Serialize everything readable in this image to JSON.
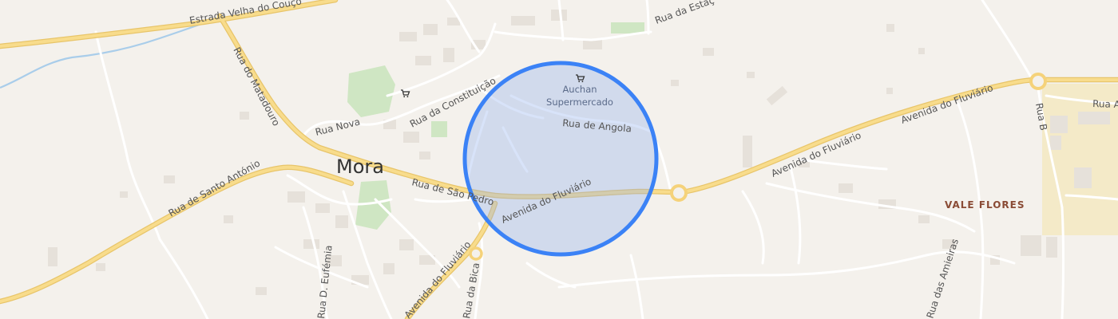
{
  "map": {
    "colors": {
      "background": "#f4f1ec",
      "major_road": "#f5d27a",
      "minor_road": "#ffffff",
      "park": "#cfe6c3",
      "water": "#a9cdea",
      "building": "#e6e1da",
      "industrial": "#f4eac8",
      "radius_fill": "#8fb0ef",
      "radius_stroke": "#3b82f6"
    },
    "labels": {
      "town": "Mora",
      "district": "VALE FLORES",
      "poi_name_line1": "Auchan",
      "poi_name_line2": "Supermercado",
      "road_estrada_velha": "Estrada Velha do Couço",
      "road_matadouro": "Rua do Matadouro",
      "road_nova": "Rua Nova",
      "road_constituicao": "Rua da Constituição",
      "road_angola": "Rua de Angola",
      "road_sao_pedro": "Rua de São Pedro",
      "road_santo_antonio": "Rua de Santo António",
      "road_fluviario_center": "Avenida do Fluviário",
      "road_fluviario_east1": "Avenida do Fluviário",
      "road_fluviario_east2": "Avenida do Fluviário",
      "road_fluviario_south": "Avenida do Fluviário",
      "road_estacao": "Rua da Estaç",
      "road_b": "Rua B",
      "road_a": "Rua A",
      "road_bica": "Rua da Bica",
      "road_amieiras": "Rua das Amieiras",
      "road_eufemia": "Rua D. Eufémia"
    },
    "icons": {
      "supermarket": "shopping-cart-icon",
      "shop": "shopping-cart-icon"
    }
  }
}
